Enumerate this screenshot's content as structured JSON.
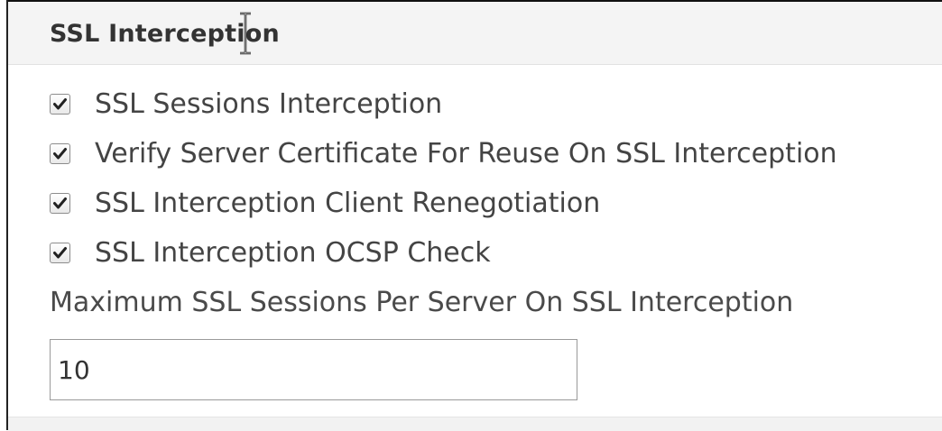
{
  "section": {
    "title": "SSL Interception"
  },
  "options": [
    {
      "label": "SSL Sessions Interception",
      "checked": true
    },
    {
      "label": "Verify Server Certificate For Reuse On SSL Interception",
      "checked": true
    },
    {
      "label": "SSL Interception Client Renegotiation",
      "checked": true
    },
    {
      "label": "SSL Interception OCSP Check",
      "checked": true
    }
  ],
  "max_sessions": {
    "label": "Maximum SSL Sessions Per Server On SSL Interception",
    "value": "10"
  },
  "colors": {
    "header_bg": "#f4f4f4",
    "text": "#444444",
    "checkmark": "#222222"
  }
}
